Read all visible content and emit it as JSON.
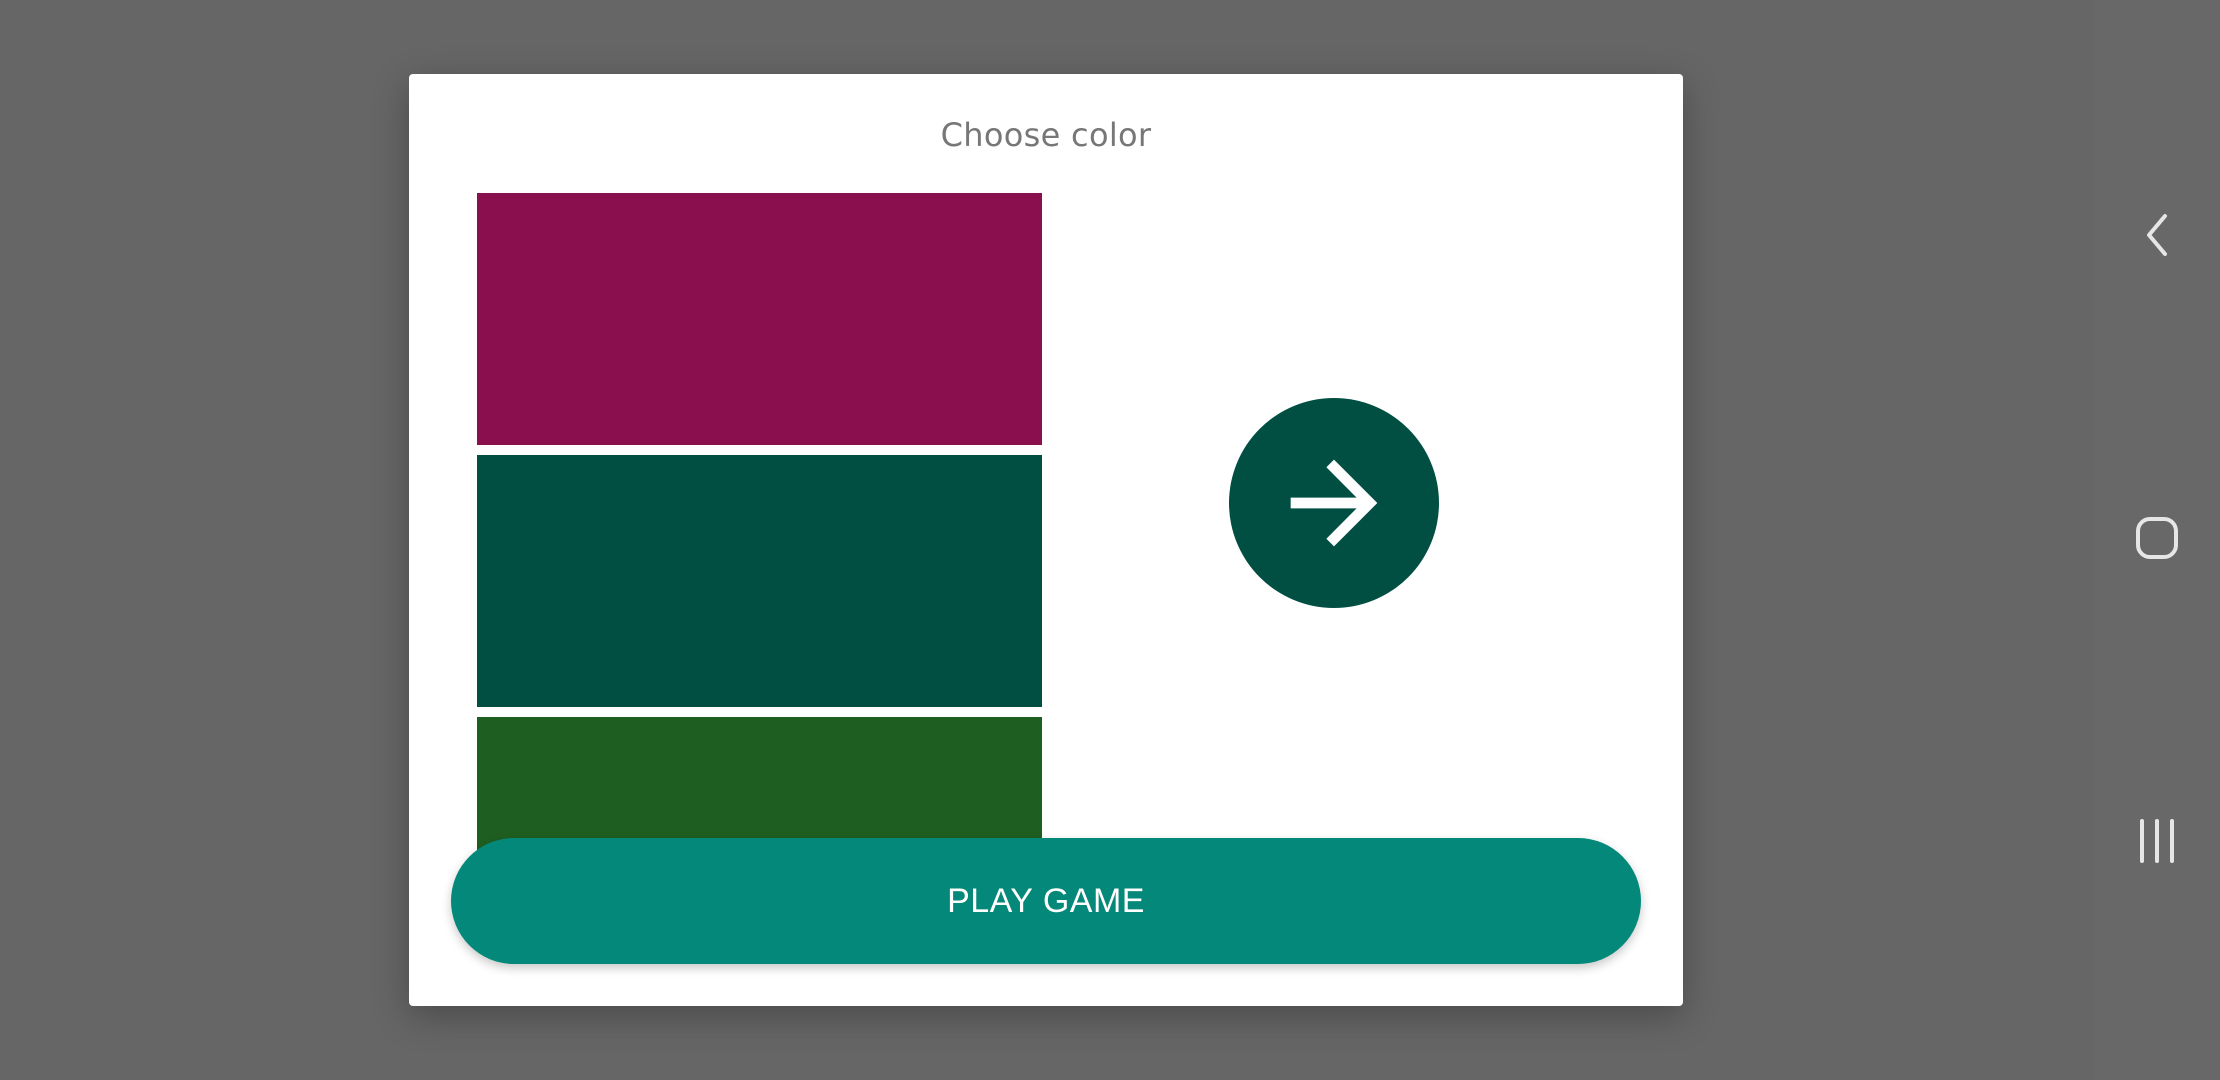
{
  "dialog": {
    "title": "Choose color",
    "play_label": "PLAY GAME"
  },
  "swatches": [
    {
      "name": "swatch-magenta",
      "color": "#8A0F4E"
    },
    {
      "name": "swatch-dark-teal",
      "color": "#014F43"
    },
    {
      "name": "swatch-dark-green",
      "color": "#1F5E21"
    }
  ],
  "preview": {
    "color": "#014F43",
    "icon": "arrow-right-icon"
  },
  "colors": {
    "backdrop": "#666666",
    "dialog_bg": "#FFFFFF",
    "title_text": "#777777",
    "play_button": "#03887A",
    "play_text": "#FFFFFF",
    "nav_icon": "#E6E6E6"
  },
  "navigation": {
    "icons": [
      "back-icon",
      "home-icon",
      "recents-icon"
    ]
  }
}
